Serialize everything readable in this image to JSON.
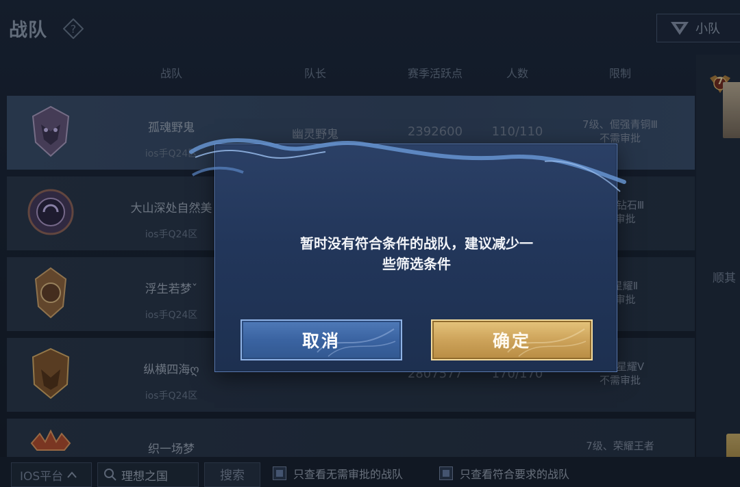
{
  "header": {
    "title": "战队",
    "team_button_label": "小队"
  },
  "columns": {
    "team": "战队",
    "captain": "队长",
    "season_points": "赛季活跃点",
    "members": "人数",
    "limit": "限制"
  },
  "rows": [
    {
      "name": "孤魂野鬼",
      "region": "ios手Q24区",
      "captain": "幽灵野鬼",
      "points": "2392600",
      "members": "110/110",
      "limit_line1": "7级、倔强青铜Ⅲ",
      "limit_line2": "不需审批"
    },
    {
      "name": "大山深处自然美",
      "region": "ios手Q24区",
      "captain": "",
      "points": "",
      "members": "",
      "limit_line1": "永恒钻石Ⅲ",
      "limit_line2": "需审批"
    },
    {
      "name": "浮生若梦ˇ",
      "region": "ios手Q24区",
      "captain": "",
      "points": "",
      "members": "",
      "limit_line1": "尊星耀Ⅱ",
      "limit_line2": "需审批"
    },
    {
      "name": "纵横四海ღ",
      "region": "ios手Q24区",
      "captain": "",
      "points": "2807577",
      "members": "170/170",
      "limit_line1": "至尊星耀Ⅴ",
      "limit_line2": "不需审批"
    },
    {
      "name": "织一场梦",
      "region": "",
      "captain": "",
      "points": "",
      "members": "",
      "limit_line1": "7级、荣耀王者",
      "limit_line2": ""
    }
  ],
  "side_panel": {
    "rank_level": "7",
    "text": "顺其"
  },
  "filter_bar": {
    "platform": "IOS平台",
    "search_value": "理想之国",
    "search_button": "搜索",
    "check_no_approval": "只查看无需审批的战队",
    "check_meets_requirements": "只查看符合要求的战队"
  },
  "dialog": {
    "message_line1": "暂时没有符合条件的战队，建议减少一",
    "message_line2": "些筛选条件",
    "cancel_label": "取消",
    "confirm_label": "确定"
  },
  "colors": {
    "cancel_button": "#3a63a1",
    "confirm_button": "#cda35a",
    "dialog_bg": "#22365a"
  }
}
